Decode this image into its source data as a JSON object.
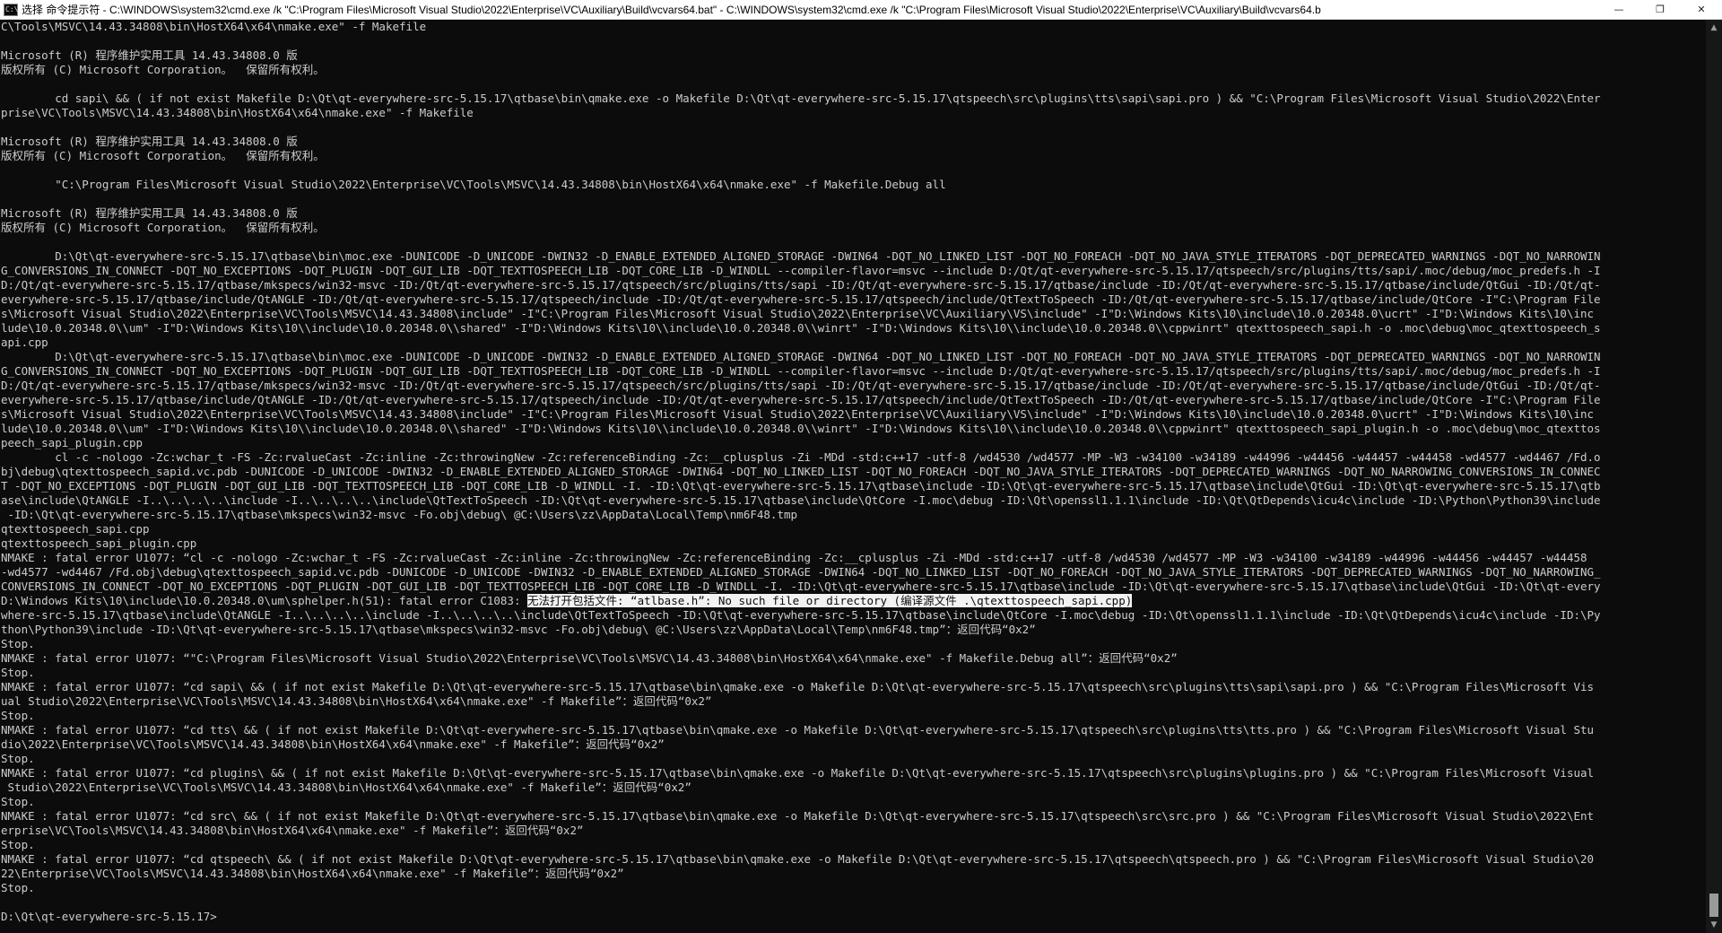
{
  "window": {
    "icon_text": "C:\\",
    "title": "选择 命令提示符 - C:\\WINDOWS\\system32\\cmd.exe /k \"C:\\Program Files\\Microsoft Visual Studio\\2022\\Enterprise\\VC\\Auxiliary\\Build\\vcvars64.bat\" - C:\\WINDOWS\\system32\\cmd.exe /k \"C:\\Program Files\\Microsoft Visual Studio\\2022\\Enterprise\\VC\\Auxiliary\\Build\\vcvars64.b",
    "minimize_glyph": "—",
    "restore_glyph": "❐",
    "close_glyph": "✕",
    "scroll_up_glyph": "▲",
    "scroll_down_glyph": "▼",
    "selection_scroll_fraction": 0.98
  },
  "console": {
    "lines": [
      "C\\Tools\\MSVC\\14.43.34808\\bin\\HostX64\\x64\\nmake.exe\" -f Makefile",
      "",
      "Microsoft (R) 程序维护实用工具 14.43.34808.0 版",
      "版权所有 (C) Microsoft Corporation。  保留所有权利。",
      "",
      "        cd sapi\\ && ( if not exist Makefile D:\\Qt\\qt-everywhere-src-5.15.17\\qtbase\\bin\\qmake.exe -o Makefile D:\\Qt\\qt-everywhere-src-5.15.17\\qtspeech\\src\\plugins\\tts\\sapi\\sapi.pro ) && \"C:\\Program Files\\Microsoft Visual Studio\\2022\\Enter",
      "prise\\VC\\Tools\\MSVC\\14.43.34808\\bin\\HostX64\\x64\\nmake.exe\" -f Makefile",
      "",
      "Microsoft (R) 程序维护实用工具 14.43.34808.0 版",
      "版权所有 (C) Microsoft Corporation。  保留所有权利。",
      "",
      "        \"C:\\Program Files\\Microsoft Visual Studio\\2022\\Enterprise\\VC\\Tools\\MSVC\\14.43.34808\\bin\\HostX64\\x64\\nmake.exe\" -f Makefile.Debug all",
      "",
      "Microsoft (R) 程序维护实用工具 14.43.34808.0 版",
      "版权所有 (C) Microsoft Corporation。  保留所有权利。",
      "",
      "        D:\\Qt\\qt-everywhere-src-5.15.17\\qtbase\\bin\\moc.exe -DUNICODE -D_UNICODE -DWIN32 -D_ENABLE_EXTENDED_ALIGNED_STORAGE -DWIN64 -DQT_NO_LINKED_LIST -DQT_NO_FOREACH -DQT_NO_JAVA_STYLE_ITERATORS -DQT_DEPRECATED_WARNINGS -DQT_NO_NARROWIN",
      "G_CONVERSIONS_IN_CONNECT -DQT_NO_EXCEPTIONS -DQT_PLUGIN -DQT_GUI_LIB -DQT_TEXTTOSPEECH_LIB -DQT_CORE_LIB -D_WINDLL --compiler-flavor=msvc --include D:/Qt/qt-everywhere-src-5.15.17/qtspeech/src/plugins/tts/sapi/.moc/debug/moc_predefs.h -I",
      "D:/Qt/qt-everywhere-src-5.15.17/qtbase/mkspecs/win32-msvc -ID:/Qt/qt-everywhere-src-5.15.17/qtspeech/src/plugins/tts/sapi -ID:/Qt/qt-everywhere-src-5.15.17/qtbase/include -ID:/Qt/qt-everywhere-src-5.15.17/qtbase/include/QtGui -ID:/Qt/qt-",
      "everywhere-src-5.15.17/qtbase/include/QtANGLE -ID:/Qt/qt-everywhere-src-5.15.17/qtspeech/include -ID:/Qt/qt-everywhere-src-5.15.17/qtspeech/include/QtTextToSpeech -ID:/Qt/qt-everywhere-src-5.15.17/qtbase/include/QtCore -I\"C:\\Program File",
      "s\\Microsoft Visual Studio\\2022\\Enterprise\\VC\\Tools\\MSVC\\14.43.34808\\include\" -I\"C:\\Program Files\\Microsoft Visual Studio\\2022\\Enterprise\\VC\\Auxiliary\\VS\\include\" -I\"D:\\Windows Kits\\10\\include\\10.0.20348.0\\ucrt\" -I\"D:\\Windows Kits\\10\\inc",
      "lude\\10.0.20348.0\\\\um\" -I\"D:\\Windows Kits\\10\\\\include\\10.0.20348.0\\\\shared\" -I\"D:\\Windows Kits\\10\\\\include\\10.0.20348.0\\\\winrt\" -I\"D:\\Windows Kits\\10\\\\include\\10.0.20348.0\\\\cppwinrt\" qtexttospeech_sapi.h -o .moc\\debug\\moc_qtexttospeech_s",
      "api.cpp",
      "        D:\\Qt\\qt-everywhere-src-5.15.17\\qtbase\\bin\\moc.exe -DUNICODE -D_UNICODE -DWIN32 -D_ENABLE_EXTENDED_ALIGNED_STORAGE -DWIN64 -DQT_NO_LINKED_LIST -DQT_NO_FOREACH -DQT_NO_JAVA_STYLE_ITERATORS -DQT_DEPRECATED_WARNINGS -DQT_NO_NARROWIN",
      "G_CONVERSIONS_IN_CONNECT -DQT_NO_EXCEPTIONS -DQT_PLUGIN -DQT_GUI_LIB -DQT_TEXTTOSPEECH_LIB -DQT_CORE_LIB -D_WINDLL --compiler-flavor=msvc --include D:/Qt/qt-everywhere-src-5.15.17/qtspeech/src/plugins/tts/sapi/.moc/debug/moc_predefs.h -I",
      "D:/Qt/qt-everywhere-src-5.15.17/qtbase/mkspecs/win32-msvc -ID:/Qt/qt-everywhere-src-5.15.17/qtspeech/src/plugins/tts/sapi -ID:/Qt/qt-everywhere-src-5.15.17/qtbase/include -ID:/Qt/qt-everywhere-src-5.15.17/qtbase/include/QtGui -ID:/Qt/qt-",
      "everywhere-src-5.15.17/qtbase/include/QtANGLE -ID:/Qt/qt-everywhere-src-5.15.17/qtspeech/include -ID:/Qt/qt-everywhere-src-5.15.17/qtspeech/include/QtTextToSpeech -ID:/Qt/qt-everywhere-src-5.15.17/qtbase/include/QtCore -I\"C:\\Program File",
      "s\\Microsoft Visual Studio\\2022\\Enterprise\\VC\\Tools\\MSVC\\14.43.34808\\include\" -I\"C:\\Program Files\\Microsoft Visual Studio\\2022\\Enterprise\\VC\\Auxiliary\\VS\\include\" -I\"D:\\Windows Kits\\10\\include\\10.0.20348.0\\ucrt\" -I\"D:\\Windows Kits\\10\\inc",
      "lude\\10.0.20348.0\\\\um\" -I\"D:\\Windows Kits\\10\\\\include\\10.0.20348.0\\\\shared\" -I\"D:\\Windows Kits\\10\\\\include\\10.0.20348.0\\\\winrt\" -I\"D:\\Windows Kits\\10\\\\include\\10.0.20348.0\\\\cppwinrt\" qtexttospeech_sapi_plugin.h -o .moc\\debug\\moc_qtexttos",
      "peech_sapi_plugin.cpp",
      "        cl -c -nologo -Zc:wchar_t -FS -Zc:rvalueCast -Zc:inline -Zc:throwingNew -Zc:referenceBinding -Zc:__cplusplus -Zi -MDd -std:c++17 -utf-8 /wd4530 /wd4577 -MP -W3 -w34100 -w34189 -w44996 -w44456 -w44457 -w44458 -wd4577 -wd4467 /Fd.o",
      "bj\\debug\\qtexttospeech_sapid.vc.pdb -DUNICODE -D_UNICODE -DWIN32 -D_ENABLE_EXTENDED_ALIGNED_STORAGE -DWIN64 -DQT_NO_LINKED_LIST -DQT_NO_FOREACH -DQT_NO_JAVA_STYLE_ITERATORS -DQT_DEPRECATED_WARNINGS -DQT_NO_NARROWING_CONVERSIONS_IN_CONNEC",
      "T -DQT_NO_EXCEPTIONS -DQT_PLUGIN -DQT_GUI_LIB -DQT_TEXTTOSPEECH_LIB -DQT_CORE_LIB -D_WINDLL -I. -ID:\\Qt\\qt-everywhere-src-5.15.17\\qtbase\\include -ID:\\Qt\\qt-everywhere-src-5.15.17\\qtbase\\include\\QtGui -ID:\\Qt\\qt-everywhere-src-5.15.17\\qtb",
      "ase\\include\\QtANGLE -I..\\..\\..\\..\\include -I..\\..\\..\\..\\include\\QtTextToSpeech -ID:\\Qt\\qt-everywhere-src-5.15.17\\qtbase\\include\\QtCore -I.moc\\debug -ID:\\Qt\\openssl1.1.1\\include -ID:\\Qt\\QtDepends\\icu4c\\include -ID:\\Python\\Python39\\include",
      " -ID:\\Qt\\qt-everywhere-src-5.15.17\\qtbase\\mkspecs\\win32-msvc -Fo.obj\\debug\\ @C:\\Users\\zz\\AppData\\Local\\Temp\\nm6F48.tmp",
      "qtexttospeech_sapi.cpp",
      "qtexttospeech_sapi_plugin.cpp",
      "NMAKE : fatal error U1077: “cl -c -nologo -Zc:wchar_t -FS -Zc:rvalueCast -Zc:inline -Zc:throwingNew -Zc:referenceBinding -Zc:__cplusplus -Zi -MDd -std:c++17 -utf-8 /wd4530 /wd4577 -MP -W3 -w34100 -w34189 -w44996 -w44456 -w44457 -w44458",
      "-wd4577 -wd4467 /Fd.obj\\debug\\qtexttospeech_sapid.vc.pdb -DUNICODE -D_UNICODE -DWIN32 -D_ENABLE_EXTENDED_ALIGNED_STORAGE -DWIN64 -DQT_NO_LINKED_LIST -DQT_NO_FOREACH -DQT_NO_JAVA_STYLE_ITERATORS -DQT_DEPRECATED_WARNINGS -DQT_NO_NARROWING_",
      "CONVERSIONS_IN_CONNECT -DQT_NO_EXCEPTIONS -DQT_PLUGIN -DQT_GUI_LIB -DQT_TEXTTOSPEECH_LIB -DQT_CORE_LIB -D_WINDLL -I. -ID:\\Qt\\qt-everywhere-src-5.15.17\\qtbase\\include -ID:\\Qt\\qt-everywhere-src-5.15.17\\qtbase\\include\\QtGui -ID:\\Qt\\qt-every",
      "where-src-5.15.17\\qtbase\\include\\QtANGLE -I..\\..\\..\\..\\include -I..\\..\\..\\..\\include\\QtTextToSpeech -ID:\\Qt\\qt-everywhere-src-5.15.17\\qtbase\\include\\QtCore -I.moc\\debug -ID:\\Qt\\openssl1.1.1\\include -ID:\\Qt\\QtDepends\\icu4c\\include -ID:\\Py",
      "thon\\Python39\\include -ID:\\Qt\\qt-everywhere-src-5.15.17\\qtbase\\mkspecs\\win32-msvc -Fo.obj\\debug\\ @C:\\Users\\zz\\AppData\\Local\\Temp\\nm6F48.tmp”：返回代码“0x2”",
      "Stop.",
      "NMAKE : fatal error U1077: “\"C:\\Program Files\\Microsoft Visual Studio\\2022\\Enterprise\\VC\\Tools\\MSVC\\14.43.34808\\bin\\HostX64\\x64\\nmake.exe\" -f Makefile.Debug all”：返回代码“0x2”",
      "Stop.",
      "NMAKE : fatal error U1077: “cd sapi\\ && ( if not exist Makefile D:\\Qt\\qt-everywhere-src-5.15.17\\qtbase\\bin\\qmake.exe -o Makefile D:\\Qt\\qt-everywhere-src-5.15.17\\qtspeech\\src\\plugins\\tts\\sapi\\sapi.pro ) && \"C:\\Program Files\\Microsoft Vis",
      "ual Studio\\2022\\Enterprise\\VC\\Tools\\MSVC\\14.43.34808\\bin\\HostX64\\x64\\nmake.exe\" -f Makefile”：返回代码“0x2”",
      "Stop.",
      "NMAKE : fatal error U1077: “cd tts\\ && ( if not exist Makefile D:\\Qt\\qt-everywhere-src-5.15.17\\qtbase\\bin\\qmake.exe -o Makefile D:\\Qt\\qt-everywhere-src-5.15.17\\qtspeech\\src\\plugins\\tts\\tts.pro ) && \"C:\\Program Files\\Microsoft Visual Stu",
      "dio\\2022\\Enterprise\\VC\\Tools\\MSVC\\14.43.34808\\bin\\HostX64\\x64\\nmake.exe\" -f Makefile”：返回代码“0x2”",
      "Stop.",
      "NMAKE : fatal error U1077: “cd plugins\\ && ( if not exist Makefile D:\\Qt\\qt-everywhere-src-5.15.17\\qtbase\\bin\\qmake.exe -o Makefile D:\\Qt\\qt-everywhere-src-5.15.17\\qtspeech\\src\\plugins\\plugins.pro ) && \"C:\\Program Files\\Microsoft Visual",
      " Studio\\2022\\Enterprise\\VC\\Tools\\MSVC\\14.43.34808\\bin\\HostX64\\x64\\nmake.exe\" -f Makefile”：返回代码“0x2”",
      "Stop.",
      "NMAKE : fatal error U1077: “cd src\\ && ( if not exist Makefile D:\\Qt\\qt-everywhere-src-5.15.17\\qtbase\\bin\\qmake.exe -o Makefile D:\\Qt\\qt-everywhere-src-5.15.17\\qtspeech\\src\\src.pro ) && \"C:\\Program Files\\Microsoft Visual Studio\\2022\\Ent",
      "erprise\\VC\\Tools\\MSVC\\14.43.34808\\bin\\HostX64\\x64\\nmake.exe\" -f Makefile”：返回代码“0x2”",
      "Stop.",
      "NMAKE : fatal error U1077: “cd qtspeech\\ && ( if not exist Makefile D:\\Qt\\qt-everywhere-src-5.15.17\\qtbase\\bin\\qmake.exe -o Makefile D:\\Qt\\qt-everywhere-src-5.15.17\\qtspeech\\qtspeech.pro ) && \"C:\\Program Files\\Microsoft Visual Studio\\20",
      "22\\Enterprise\\VC\\Tools\\MSVC\\14.43.34808\\bin\\HostX64\\x64\\nmake.exe\" -f Makefile”：返回代码“0x2”",
      "Stop.",
      "",
      "D:\\Qt\\qt-everywhere-src-5.15.17>"
    ],
    "error_line": {
      "prefix": "D:\\Windows Kits\\10\\include\\10.0.20348.0\\um\\sphelper.h(51): fatal error C1083: ",
      "selected": "无法打开包括文件: “atlbase.h”: No such file or directory (编译源文件 .\\qtexttospeech_sapi.cpp)",
      "insert_after_index": 39
    },
    "colors": {
      "background": "#0c0c0c",
      "text": "#cccccc",
      "selection_bg": "#f2f2f2",
      "selection_text": "#0c0c0c"
    }
  }
}
